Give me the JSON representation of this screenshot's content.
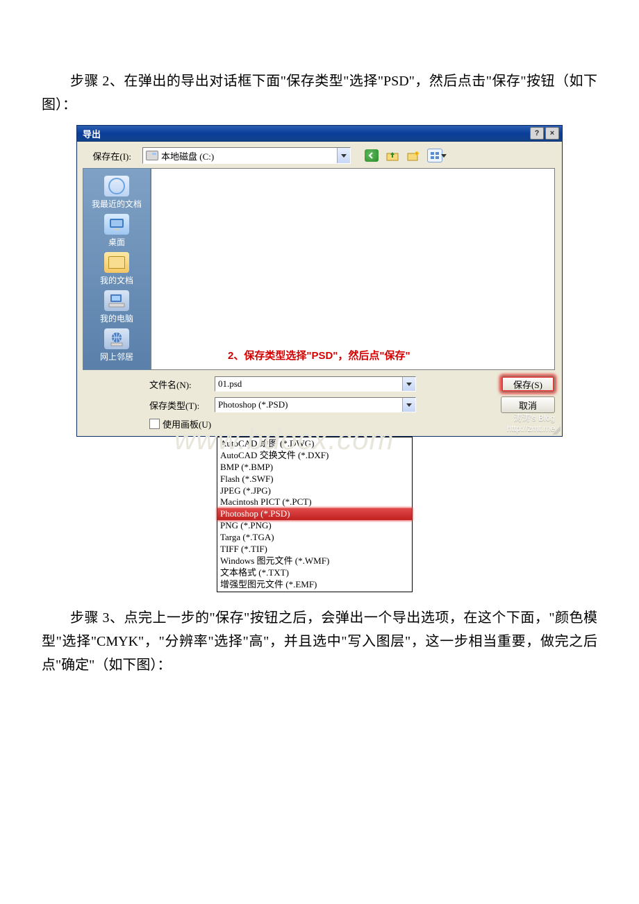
{
  "doc": {
    "para1": "　　步骤 2、在弹出的导出对话框下面\"保存类型\"选择\"PSD\"，然后点击\"保存\"按钮（如下图）：",
    "para2": "　　步骤 3、点完上一步的\"保存\"按钮之后，会弹出一个导出选项，在这个下面，\"颜色模型\"选择\"CMYK\"，\"分辨率\"选择\"高\"，并且选中\"写入图层\"，这一步相当重要，做完之后点\"确定\"（如下图）："
  },
  "dialog": {
    "title": "导出",
    "help_glyph": "?",
    "close_glyph": "×",
    "save_in_label": "保存在(I):",
    "location_text": "本地磁盘 (C:)",
    "places": {
      "recent": "我最近的文档",
      "desktop": "桌面",
      "docs": "我的文档",
      "computer": "我的电脑",
      "network": "网上邻居"
    },
    "annotation": "2、保存类型选择\"PSD\"，然后点\"保存\"",
    "filename_label": "文件名(N):",
    "filename_value": "01.psd",
    "filetype_label": "保存类型(T):",
    "filetype_value": "Photoshop (*.PSD)",
    "artboard_checkbox": "使用画板(U)",
    "save_btn": "保存(S)",
    "cancel_btn": "取消",
    "watermark_line1": "涛涛's Blog",
    "watermark_line2": "http://zmt.me",
    "bg_watermark": "www.bdocx.com",
    "options": {
      "opt0": "AutoCAD 绘图 (*.DWG)",
      "opt1": "AutoCAD 交换文件 (*.DXF)",
      "opt2": "BMP (*.BMP)",
      "opt3": "Flash (*.SWF)",
      "opt4": "JPEG (*.JPG)",
      "opt5": "Macintosh PICT (*.PCT)",
      "opt6": "Photoshop (*.PSD)",
      "opt7": "PNG (*.PNG)",
      "opt8": "Targa (*.TGA)",
      "opt9": "TIFF (*.TIF)",
      "opt10": "Windows 图元文件 (*.WMF)",
      "opt11": "文本格式 (*.TXT)",
      "opt12": "增强型图元文件 (*.EMF)"
    }
  }
}
